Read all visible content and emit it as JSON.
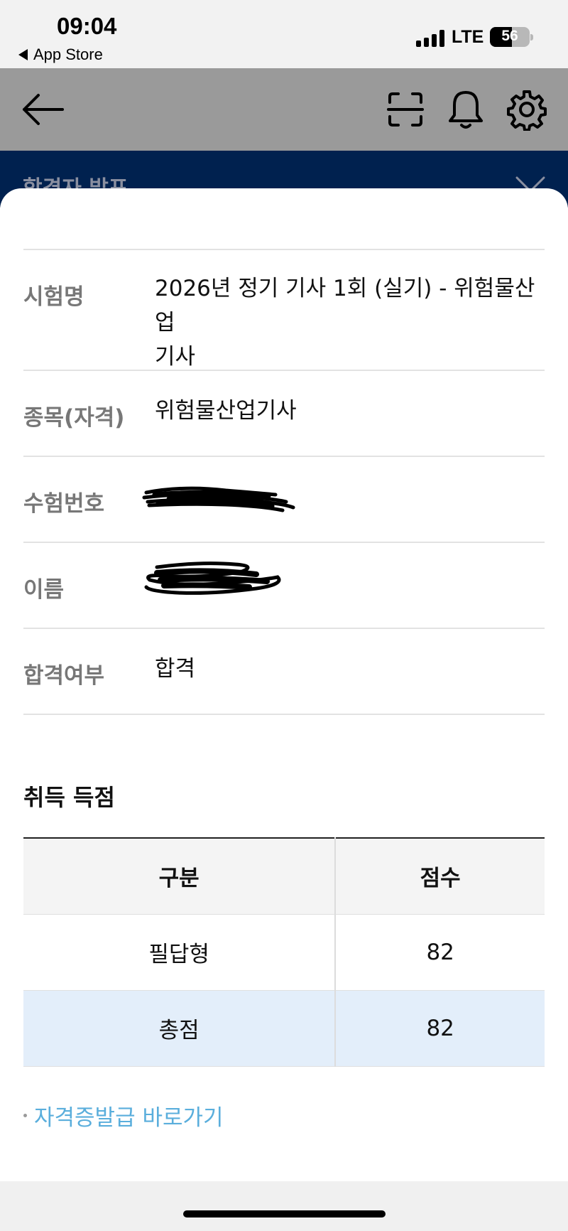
{
  "status_bar": {
    "time": "09:04",
    "back_label": "App Store",
    "network": "LTE",
    "battery": "56",
    "battery_level_percent": 56
  },
  "header": {
    "icons": [
      "back-arrow-icon",
      "scan-icon",
      "bell-icon",
      "gear-icon"
    ]
  },
  "banner": {
    "title": "합격자 발표"
  },
  "info": {
    "exam_name_label": "시험명",
    "exam_name_line1": "2026년 정기 기사 1회 (실기) - 위험물산업",
    "exam_name_line2": "기사",
    "category_label": "종목(자격)",
    "category_value": "위험물산업기사",
    "exam_number_label": "수험번호",
    "name_label": "이름",
    "result_label": "합격여부",
    "result_value": "합격"
  },
  "scores": {
    "title": "취득 득점",
    "headers": [
      "구분",
      "점수"
    ],
    "rows": [
      {
        "category": "필답형",
        "score": "82"
      },
      {
        "category": "총점",
        "score": "82"
      }
    ]
  },
  "links": {
    "certificate": "자격증발급 바로가기"
  }
}
